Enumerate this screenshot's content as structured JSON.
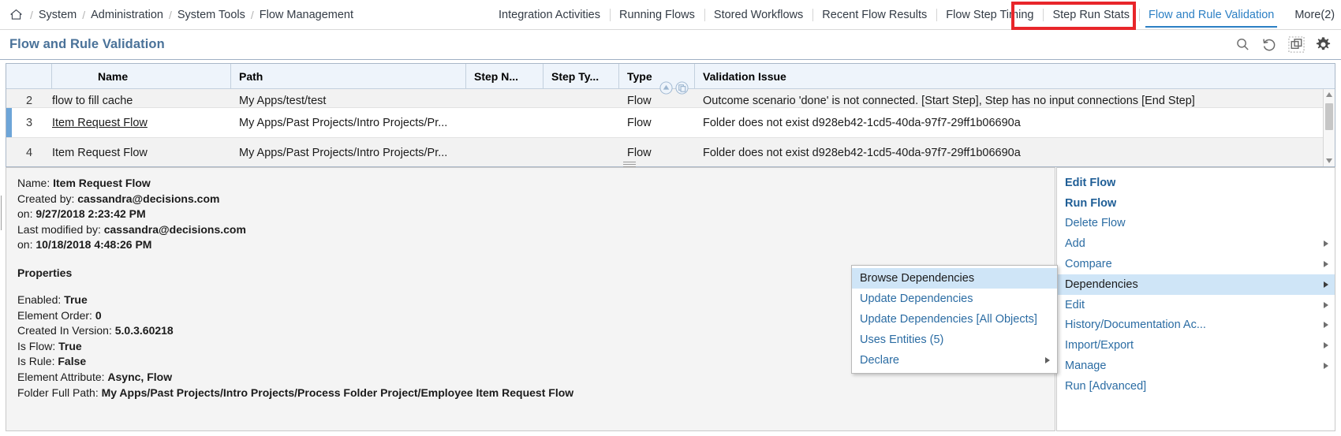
{
  "breadcrumb": {
    "home_icon": "home-icon",
    "items": [
      "System",
      "Administration",
      "System Tools",
      "Flow Management"
    ],
    "separator": "/"
  },
  "nav": {
    "tabs": [
      {
        "label": "Integration Activities",
        "active": false
      },
      {
        "label": "Running Flows",
        "active": false
      },
      {
        "label": "Stored Workflows",
        "active": false
      },
      {
        "label": "Recent Flow Results",
        "active": false
      },
      {
        "label": "Flow Step Timing",
        "active": false
      },
      {
        "label": "Step Run Stats",
        "active": false
      },
      {
        "label": "Flow and Rule Validation",
        "active": true
      }
    ],
    "more_label": "More(2)",
    "highlight_color": "#e8262a",
    "active_color": "#2b7fc4",
    "refresh_icon": "refresh-icon",
    "overflow_icon": "kebab-menu-icon"
  },
  "page": {
    "title": "Flow and Rule Validation",
    "title_color": "#4a7299",
    "toolbar": [
      {
        "icon": "search-icon"
      },
      {
        "icon": "undo-history-icon"
      },
      {
        "icon": "copy-window-icon"
      },
      {
        "icon": "gear-icon"
      }
    ]
  },
  "grid": {
    "columns": [
      {
        "key": "idx",
        "label": ""
      },
      {
        "key": "name",
        "label": "Name"
      },
      {
        "key": "path",
        "label": "Path"
      },
      {
        "key": "step_name",
        "label": "Step N..."
      },
      {
        "key": "step_type",
        "label": "Step Ty..."
      },
      {
        "key": "type",
        "label": "Type"
      },
      {
        "key": "validation_issue",
        "label": "Validation Issue"
      }
    ],
    "sort_icons": [
      "sort-ascending-icon",
      "group-columns-icon"
    ],
    "rows": [
      {
        "idx": "2",
        "name": "flow to fill cache",
        "path": "My Apps/test/test",
        "step_name": "",
        "step_type": "",
        "type": "Flow",
        "validation_issue": "Outcome scenario 'done' is not connected. [Start Step], Step has no input connections [End Step]",
        "selected": false,
        "partial": true
      },
      {
        "idx": "3",
        "name": "Item Request Flow",
        "path": "My Apps/Past Projects/Intro Projects/Pr...",
        "step_name": "",
        "step_type": "",
        "type": "Flow",
        "validation_issue": "Folder does not exist d928eb42-1cd5-40da-97f7-29ff1b06690a",
        "selected": true,
        "partial": false
      },
      {
        "idx": "4",
        "name": "Item Request Flow",
        "path": "My Apps/Past Projects/Intro Projects/Pr...",
        "step_name": "",
        "step_type": "",
        "type": "Flow",
        "validation_issue": "Folder does not exist d928eb42-1cd5-40da-97f7-29ff1b06690a",
        "selected": false,
        "partial": false
      }
    ],
    "scrollbar": {
      "up_icon": "scroll-up-icon",
      "down_icon": "scroll-down-icon"
    }
  },
  "details": {
    "name_label": "Name:",
    "name_value": "Item Request Flow",
    "created_by_label": "Created by:",
    "created_by_value": "cassandra@decisions.com",
    "created_on_label": "on:",
    "created_on_value": "9/27/2018 2:23:42 PM",
    "modified_by_label": "Last modified by:",
    "modified_by_value": "cassandra@decisions.com",
    "modified_on_label": "on:",
    "modified_on_value": "10/18/2018 4:48:26 PM",
    "properties_heading": "Properties",
    "properties": [
      {
        "label": "Enabled:",
        "value": "True"
      },
      {
        "label": "Element Order:",
        "value": "0"
      },
      {
        "label": "Created In Version:",
        "value": "5.0.3.60218"
      },
      {
        "label": "Is Flow:",
        "value": "True"
      },
      {
        "label": "Is Rule:",
        "value": "False"
      },
      {
        "label": "Element Attribute:",
        "value": "Async, Flow"
      },
      {
        "label": "Folder Full Path:",
        "value": "My Apps/Past Projects/Intro Projects/Process Folder Project/Employee Item Request Flow"
      }
    ]
  },
  "context_menu": {
    "items": [
      {
        "label": "Edit Flow",
        "bold": true,
        "submenu": false,
        "highlighted": false
      },
      {
        "label": "Run Flow",
        "bold": true,
        "submenu": false,
        "highlighted": false
      },
      {
        "label": "Delete Flow",
        "bold": false,
        "submenu": false,
        "highlighted": false
      },
      {
        "label": "Add",
        "bold": false,
        "submenu": true,
        "highlighted": false
      },
      {
        "label": "Compare",
        "bold": false,
        "submenu": true,
        "highlighted": false
      },
      {
        "label": "Dependencies",
        "bold": false,
        "submenu": true,
        "highlighted": true
      },
      {
        "label": "Edit",
        "bold": false,
        "submenu": true,
        "highlighted": false
      },
      {
        "label": "History/Documentation Ac...",
        "bold": false,
        "submenu": true,
        "highlighted": false
      },
      {
        "label": "Import/Export",
        "bold": false,
        "submenu": true,
        "highlighted": false
      },
      {
        "label": "Manage",
        "bold": false,
        "submenu": true,
        "highlighted": false
      },
      {
        "label": "Run [Advanced]",
        "bold": false,
        "submenu": false,
        "highlighted": false
      }
    ]
  },
  "submenu": {
    "items": [
      {
        "label": "Browse Dependencies",
        "submenu": false,
        "highlighted": true
      },
      {
        "label": "Update Dependencies",
        "submenu": false,
        "highlighted": false
      },
      {
        "label": "Update Dependencies [All Objects]",
        "submenu": false,
        "highlighted": false
      },
      {
        "label": "Uses Entities (5)",
        "submenu": false,
        "highlighted": false
      },
      {
        "label": "Declare",
        "submenu": true,
        "highlighted": false
      }
    ]
  }
}
